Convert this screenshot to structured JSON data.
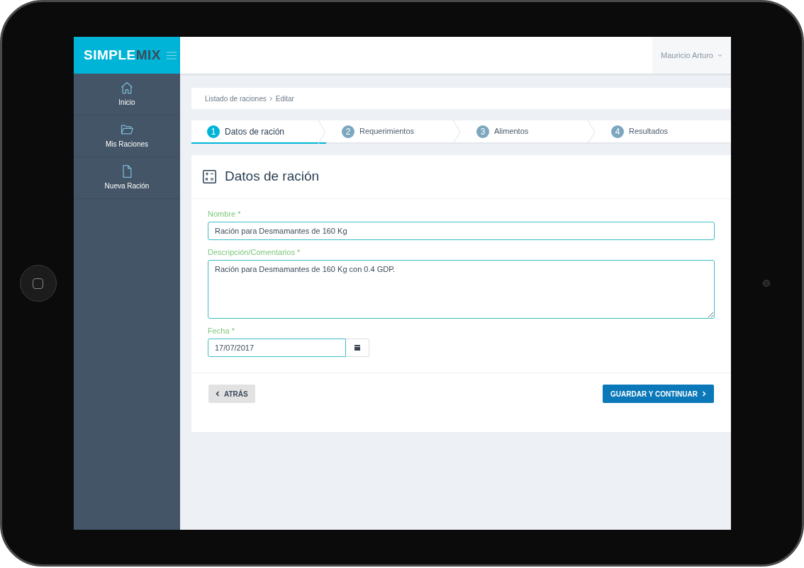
{
  "logo": {
    "part_1": "SIMPLE",
    "part_2": "MIX"
  },
  "sidebar": {
    "items": [
      {
        "kind": "home",
        "label": "Inicio",
        "selected": false
      },
      {
        "kind": "folder",
        "label": "Mis Raciones",
        "selected": false
      },
      {
        "kind": "file",
        "label": "Nueva Ración",
        "selected": false
      }
    ]
  },
  "user_menu": {
    "name": "Mauricio Arturo"
  },
  "breadcrumb": [
    "Listado de raciones",
    "Editar"
  ],
  "steps": [
    {
      "number": "1",
      "label": "Datos de ración",
      "selected": true
    },
    {
      "number": "2",
      "label": "Requerimientos",
      "selected": false
    },
    {
      "number": "3",
      "label": "Alimentos",
      "selected": false
    },
    {
      "number": "4",
      "label": "Resultados",
      "selected": false
    }
  ],
  "form": {
    "title": "Datos de ración",
    "fields": [
      {
        "kind": "text",
        "label": "Nombre *",
        "value": "Ración para Desmamantes de 160 Kg"
      },
      {
        "kind": "textarea",
        "label": "Descripción/Comentarios *",
        "value": "Ración para Desmamantes de 160 Kg con 0.4 GDP."
      },
      {
        "kind": "date",
        "label": "Fecha *",
        "value": "17/07/2017"
      }
    ],
    "back_button": "ATRÁS",
    "next_button": "GUARDAR Y CONTINUAR"
  }
}
